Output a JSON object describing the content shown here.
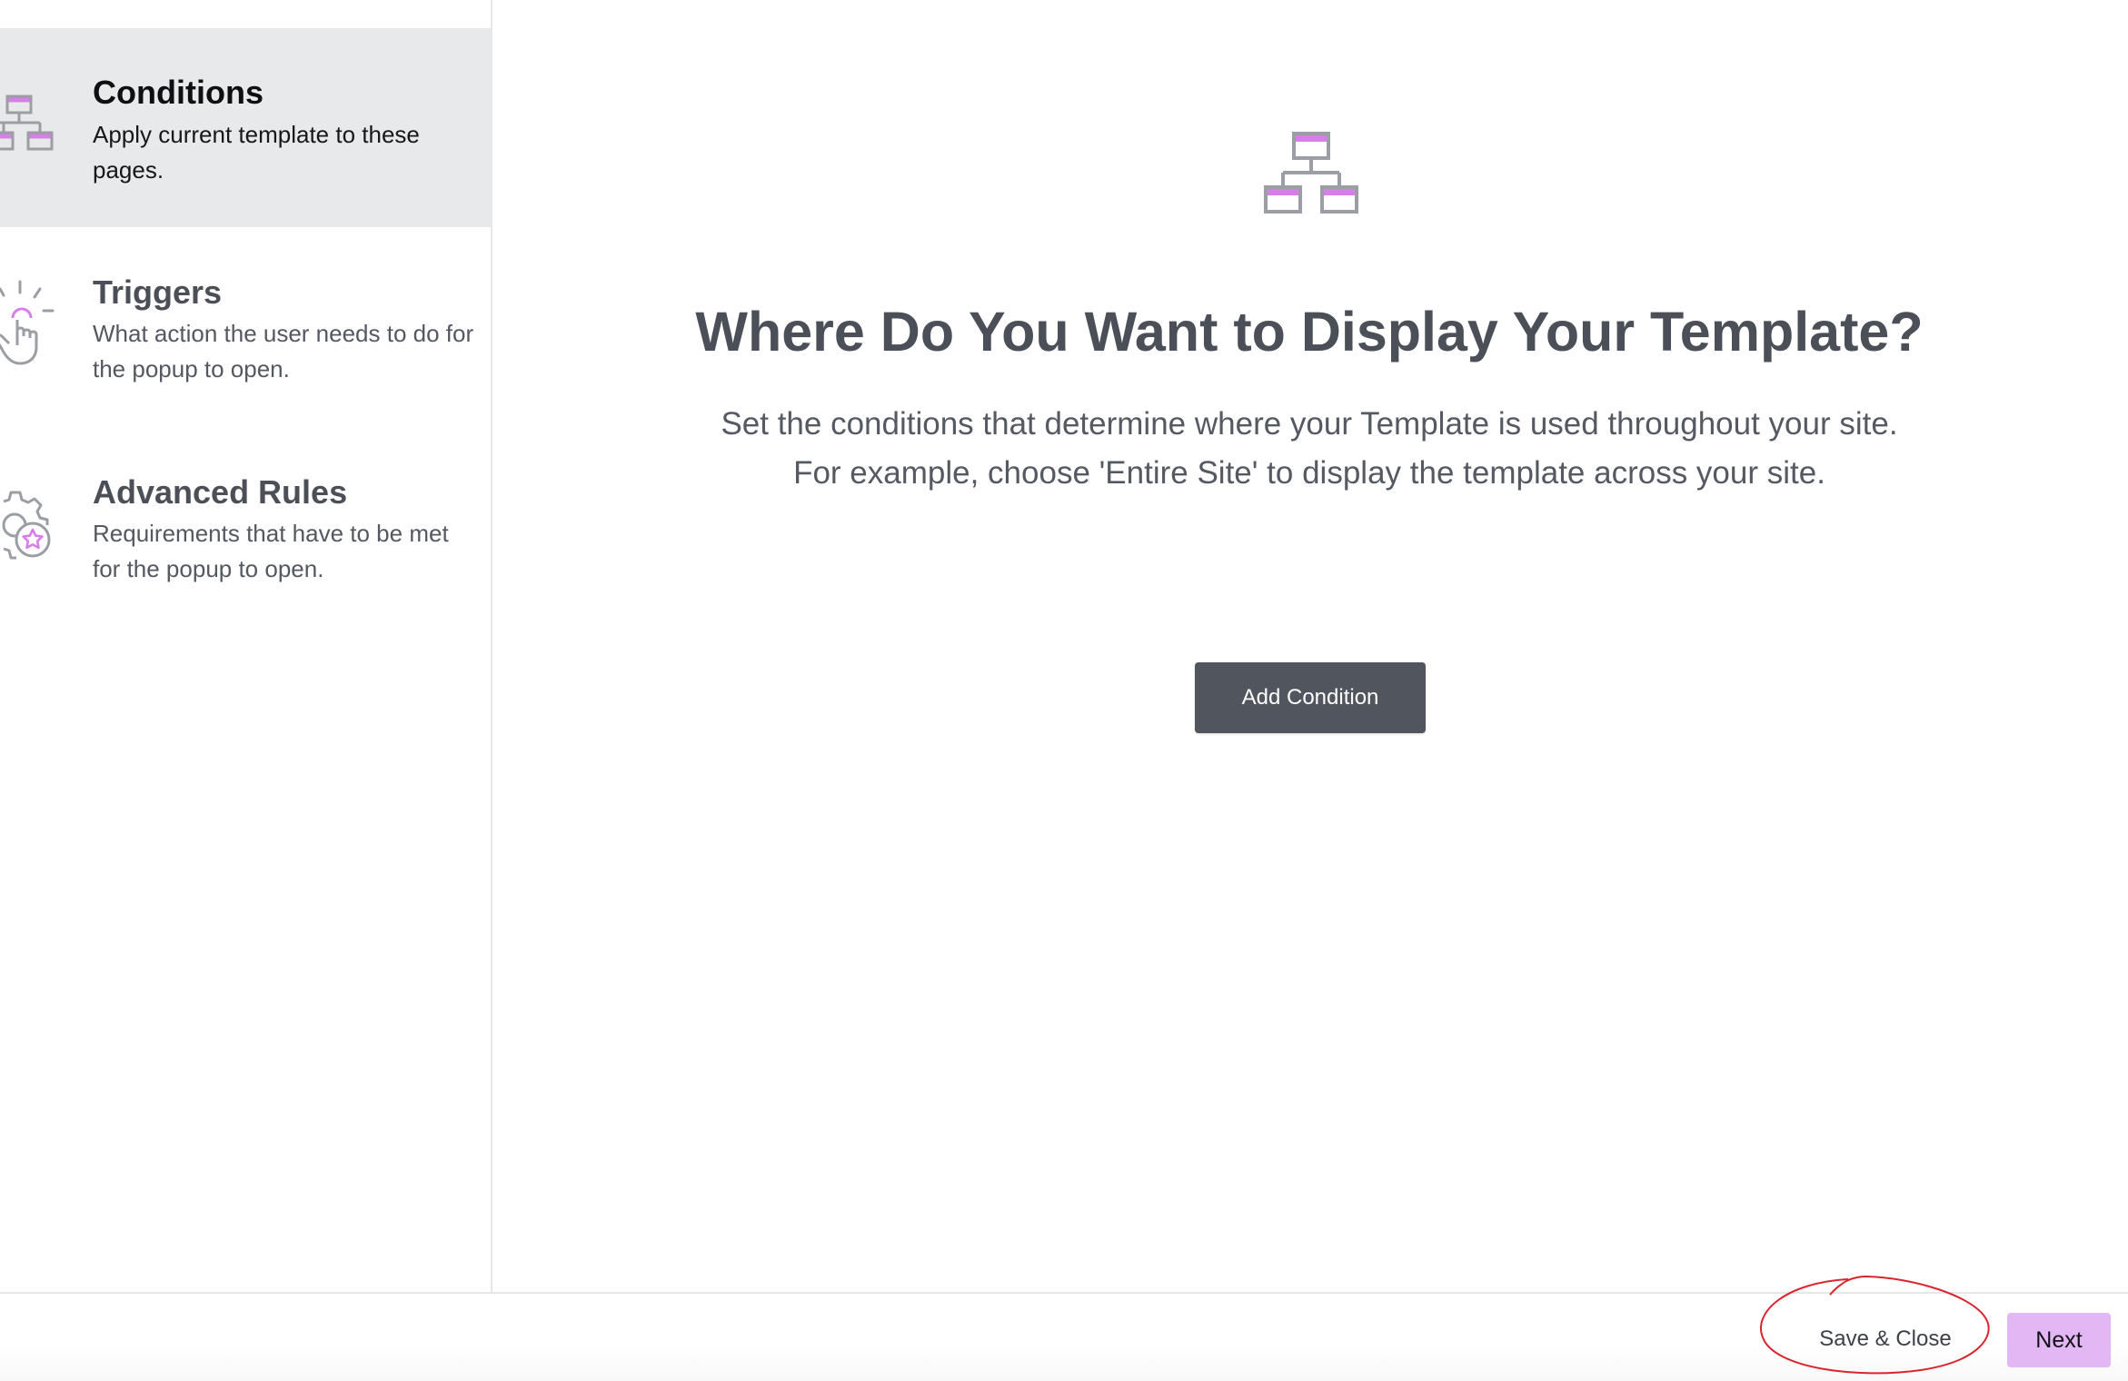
{
  "sidebar": {
    "items": [
      {
        "title": "Conditions",
        "description": "Apply current template to these pages.",
        "active": true,
        "icon": "sitemap-icon"
      },
      {
        "title": "Triggers",
        "description": "What action the user needs to do for the popup to open.",
        "active": false,
        "icon": "pointer-click-icon"
      },
      {
        "title": "Advanced Rules",
        "description": "Requirements that have to be met for the popup to open.",
        "active": false,
        "icon": "gear-star-icon"
      }
    ]
  },
  "main": {
    "icon": "sitemap-icon",
    "heading": "Where Do You Want to Display Your Template?",
    "subtext_line1": "Set the conditions that determine where your Template is used throughout your site.",
    "subtext_line2": "For example, choose 'Entire Site' to display the template across your site.",
    "add_condition_label": "Add Condition"
  },
  "footer": {
    "save_close_label": "Save & Close",
    "next_label": "Next"
  },
  "colors": {
    "accent": "#e3b7f4",
    "icon_pink": "#d77ee8",
    "icon_gray": "#9b9ea5",
    "primary_button": "#51555d",
    "annotation": "#d9262e",
    "active_bg": "#e8e9eb"
  }
}
